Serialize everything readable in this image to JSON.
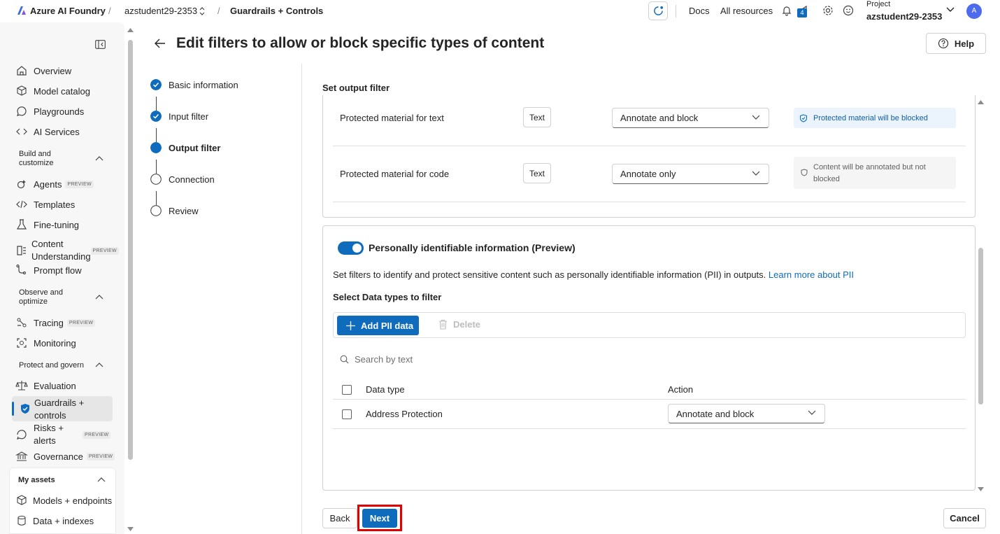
{
  "topbar": {
    "app_name": "Azure AI Foundry",
    "project_crumb": "azstudent29-2353",
    "page_crumb": "Guardrails + Controls",
    "docs": "Docs",
    "all_resources": "All resources",
    "notification_count": "4",
    "project_label": "Project",
    "project_name": "azstudent29-2353",
    "avatar_initial": "A"
  },
  "sidebar": {
    "items_top": [
      "Overview",
      "Model catalog",
      "Playgrounds",
      "AI Services"
    ],
    "section_build": "Build and customize",
    "agents": "Agents",
    "templates": "Templates",
    "fine_tuning": "Fine-tuning",
    "content_understanding": "Content Understanding",
    "prompt_flow": "Prompt flow",
    "section_observe": "Observe and optimize",
    "tracing": "Tracing",
    "monitoring": "Monitoring",
    "section_protect": "Protect and govern",
    "evaluation": "Evaluation",
    "guardrails": "Guardrails + controls",
    "risks": "Risks + alerts",
    "governance": "Governance",
    "preview_badge": "PREVIEW",
    "section_assets": "My assets",
    "models_endpoints": "Models + endpoints",
    "data_indexes": "Data + indexes"
  },
  "page": {
    "title": "Edit filters to allow or block specific types of content",
    "help": "Help"
  },
  "steps": [
    {
      "label": "Basic information",
      "state": "done"
    },
    {
      "label": "Input filter",
      "state": "done"
    },
    {
      "label": "Output filter",
      "state": "current"
    },
    {
      "label": "Connection",
      "state": "todo"
    },
    {
      "label": "Review",
      "state": "todo"
    }
  ],
  "output_filter": {
    "heading": "Set output filter",
    "rows": [
      {
        "name": "Protected material for text",
        "tag": "Text",
        "action": "Annotate and block",
        "note": "Protected material will be blocked",
        "note_type": "info"
      },
      {
        "name": "Protected material for code",
        "tag": "Text",
        "action": "Annotate only",
        "note": "Content will be annotated but not blocked",
        "note_type": "neutral"
      }
    ]
  },
  "pii": {
    "toggle_on": true,
    "title": "Personally identifiable information (Preview)",
    "description": "Set filters to identify and protect sensitive content such as personally identifiable information (PII) in outputs.",
    "learn_more": "Learn more about PII",
    "select_label": "Select Data types to filter",
    "add_button": "Add PII data",
    "delete_button": "Delete",
    "search_placeholder": "Search by text",
    "col_data_type": "Data type",
    "col_action": "Action",
    "rows": [
      {
        "data_type": "Address Protection",
        "action": "Annotate and block"
      }
    ]
  },
  "footer": {
    "back": "Back",
    "next": "Next",
    "cancel": "Cancel"
  },
  "colors": {
    "accent": "#0f6cbd",
    "highlight_border": "#e00000",
    "info_bg": "#ebf3fc"
  }
}
